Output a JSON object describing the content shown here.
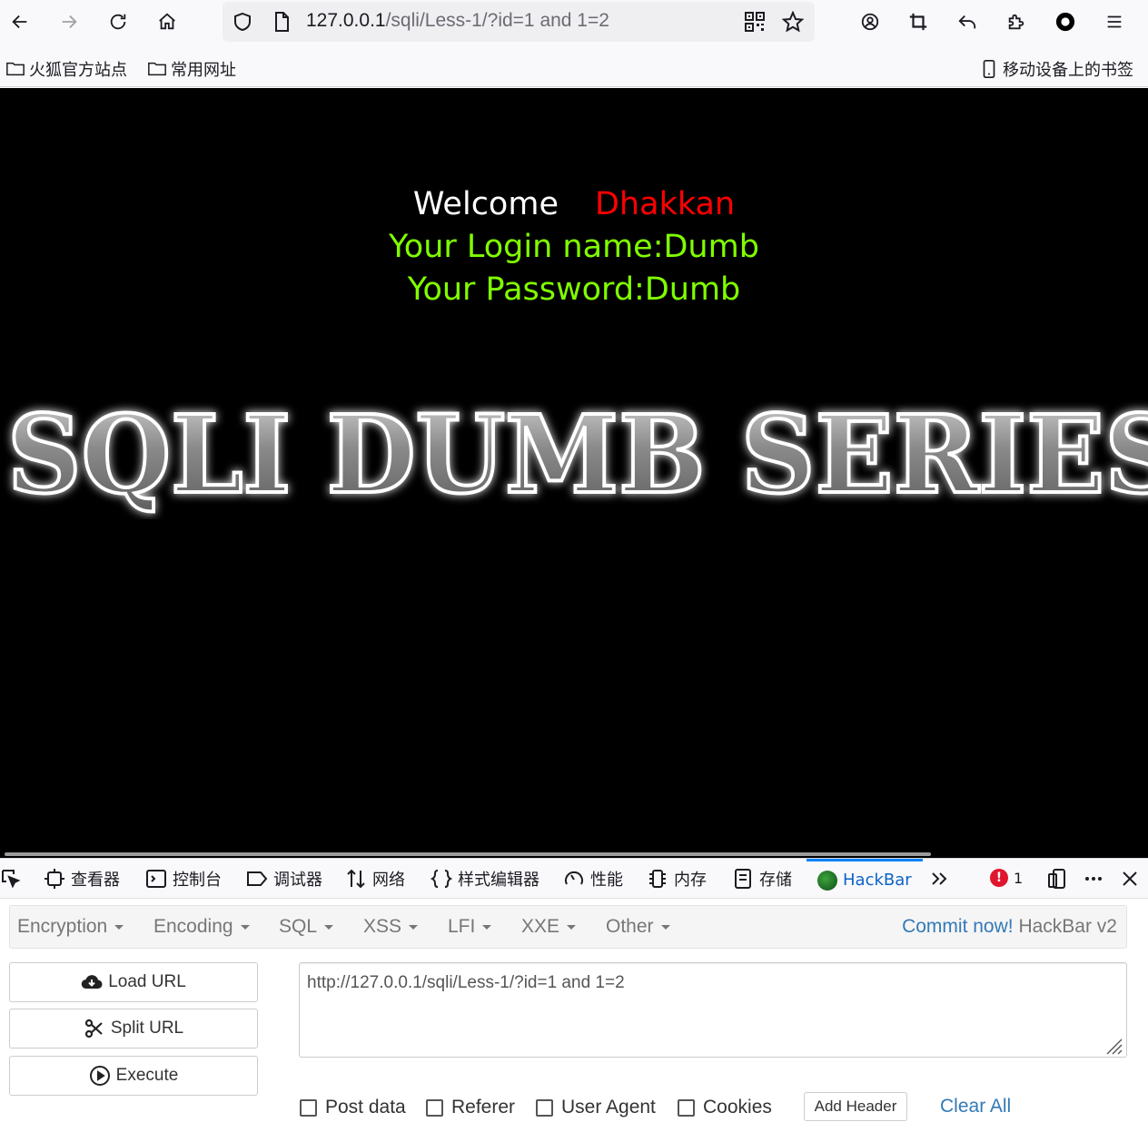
{
  "browser": {
    "url_host": "127.0.0.1",
    "url_path": "/sqli/Less-1/?id=1 and 1=2",
    "bookmarks": [
      {
        "label": "火狐官方站点"
      },
      {
        "label": "常用网址"
      }
    ],
    "mobile_bookmarks": "移动设备上的书签"
  },
  "page": {
    "welcome": "Welcome",
    "name": "Dhakkan",
    "login_line": "Your Login name:Dumb",
    "password_line": "Your Password:Dumb",
    "banner_text": "SQLI DUMB SERIES",
    "colors": {
      "background": "#000000",
      "welcome": "#ffffff",
      "name": "#ff0000",
      "credentials": "#80ff00"
    }
  },
  "devtools": {
    "tabs": [
      {
        "label": "查看器",
        "icon": "inspector-icon"
      },
      {
        "label": "控制台",
        "icon": "console-icon"
      },
      {
        "label": "调试器",
        "icon": "debugger-icon"
      },
      {
        "label": "网络",
        "icon": "network-icon"
      },
      {
        "label": "样式编辑器",
        "icon": "style-editor-icon"
      },
      {
        "label": "性能",
        "icon": "performance-icon"
      },
      {
        "label": "内存",
        "icon": "memory-icon"
      },
      {
        "label": "存储",
        "icon": "storage-icon"
      },
      {
        "label": "HackBar",
        "icon": "hackbar-icon",
        "active": true
      }
    ],
    "error_count": "1"
  },
  "hackbar": {
    "menus": [
      "Encryption",
      "Encoding",
      "SQL",
      "XSS",
      "LFI",
      "XXE",
      "Other"
    ],
    "commit_link": "Commit now!",
    "version": "HackBar v2",
    "buttons": {
      "load_url": "Load URL",
      "split_url": "Split URL",
      "execute": "Execute"
    },
    "url_value": "http://127.0.0.1/sqli/Less-1/?id=1 and 1=2",
    "checkboxes": [
      "Post data",
      "Referer",
      "User Agent",
      "Cookies"
    ],
    "add_header": "Add Header",
    "clear_all": "Clear All",
    "accent": "#337ab7"
  }
}
